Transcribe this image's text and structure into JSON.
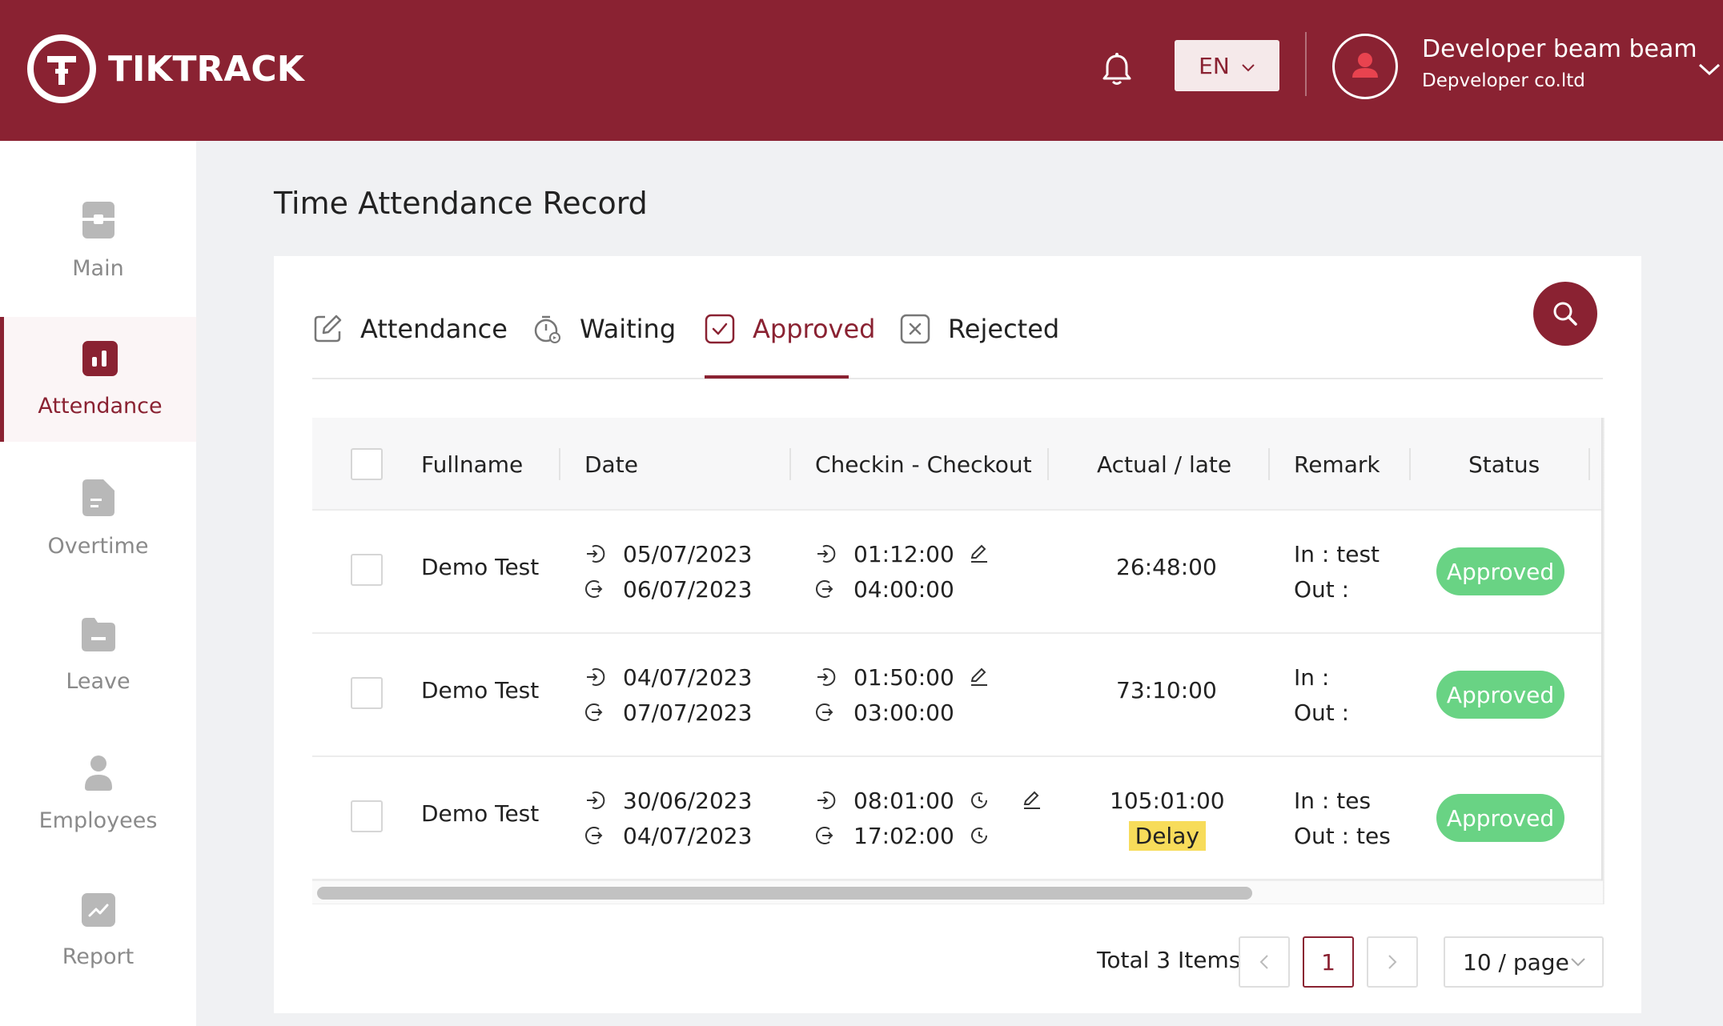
{
  "app": {
    "brand": "TIKTRACK",
    "language": "EN",
    "user_name": "Developer beam beam",
    "user_company": "Depveloper co.ltd"
  },
  "sidebar": {
    "items": [
      {
        "label": "Main",
        "icon": "main-icon"
      },
      {
        "label": "Attendance",
        "icon": "attendance-icon",
        "active": true
      },
      {
        "label": "Overtime",
        "icon": "overtime-icon"
      },
      {
        "label": "Leave",
        "icon": "leave-icon"
      },
      {
        "label": "Employees",
        "icon": "employees-icon"
      },
      {
        "label": "Report",
        "icon": "report-icon"
      }
    ]
  },
  "page": {
    "title": "Time Attendance Record"
  },
  "tabs": [
    {
      "label": "Attendance",
      "icon": "edit-icon"
    },
    {
      "label": "Waiting",
      "icon": "timer-icon"
    },
    {
      "label": "Approved",
      "icon": "check-box-icon",
      "active": true
    },
    {
      "label": "Rejected",
      "icon": "x-box-icon"
    }
  ],
  "table": {
    "columns": [
      "Fullname",
      "Date",
      "Checkin - Checkout",
      "Actual / late",
      "Remark",
      "Status"
    ],
    "rows": [
      {
        "fullname": "Demo Test",
        "date_in": "05/07/2023",
        "date_out": "06/07/2023",
        "checkin": "01:12:00",
        "checkout": "04:00:00",
        "actual": "26:48:00",
        "late": "",
        "remark_in": "In : test",
        "remark_out": "Out :",
        "status": "Approved"
      },
      {
        "fullname": "Demo Test",
        "date_in": "04/07/2023",
        "date_out": "07/07/2023",
        "checkin": "01:50:00",
        "checkout": "03:00:00",
        "actual": "73:10:00",
        "late": "",
        "remark_in": "In :",
        "remark_out": "Out :",
        "status": "Approved"
      },
      {
        "fullname": "Demo Test",
        "date_in": "30/06/2023",
        "date_out": "04/07/2023",
        "checkin": "08:01:00",
        "checkout": "17:02:00",
        "actual": "105:01:00",
        "late": "Delay",
        "remark_in": "In : tes",
        "remark_out": "Out : tes",
        "status": "Approved"
      }
    ]
  },
  "pagination": {
    "total_text": "Total 3 Items",
    "prev": "<",
    "current_page": "1",
    "next": ">",
    "page_size": "10 / page"
  },
  "colors": {
    "brand": "#8a2232",
    "approved": "#69d384",
    "delay": "#f7dc5a"
  }
}
